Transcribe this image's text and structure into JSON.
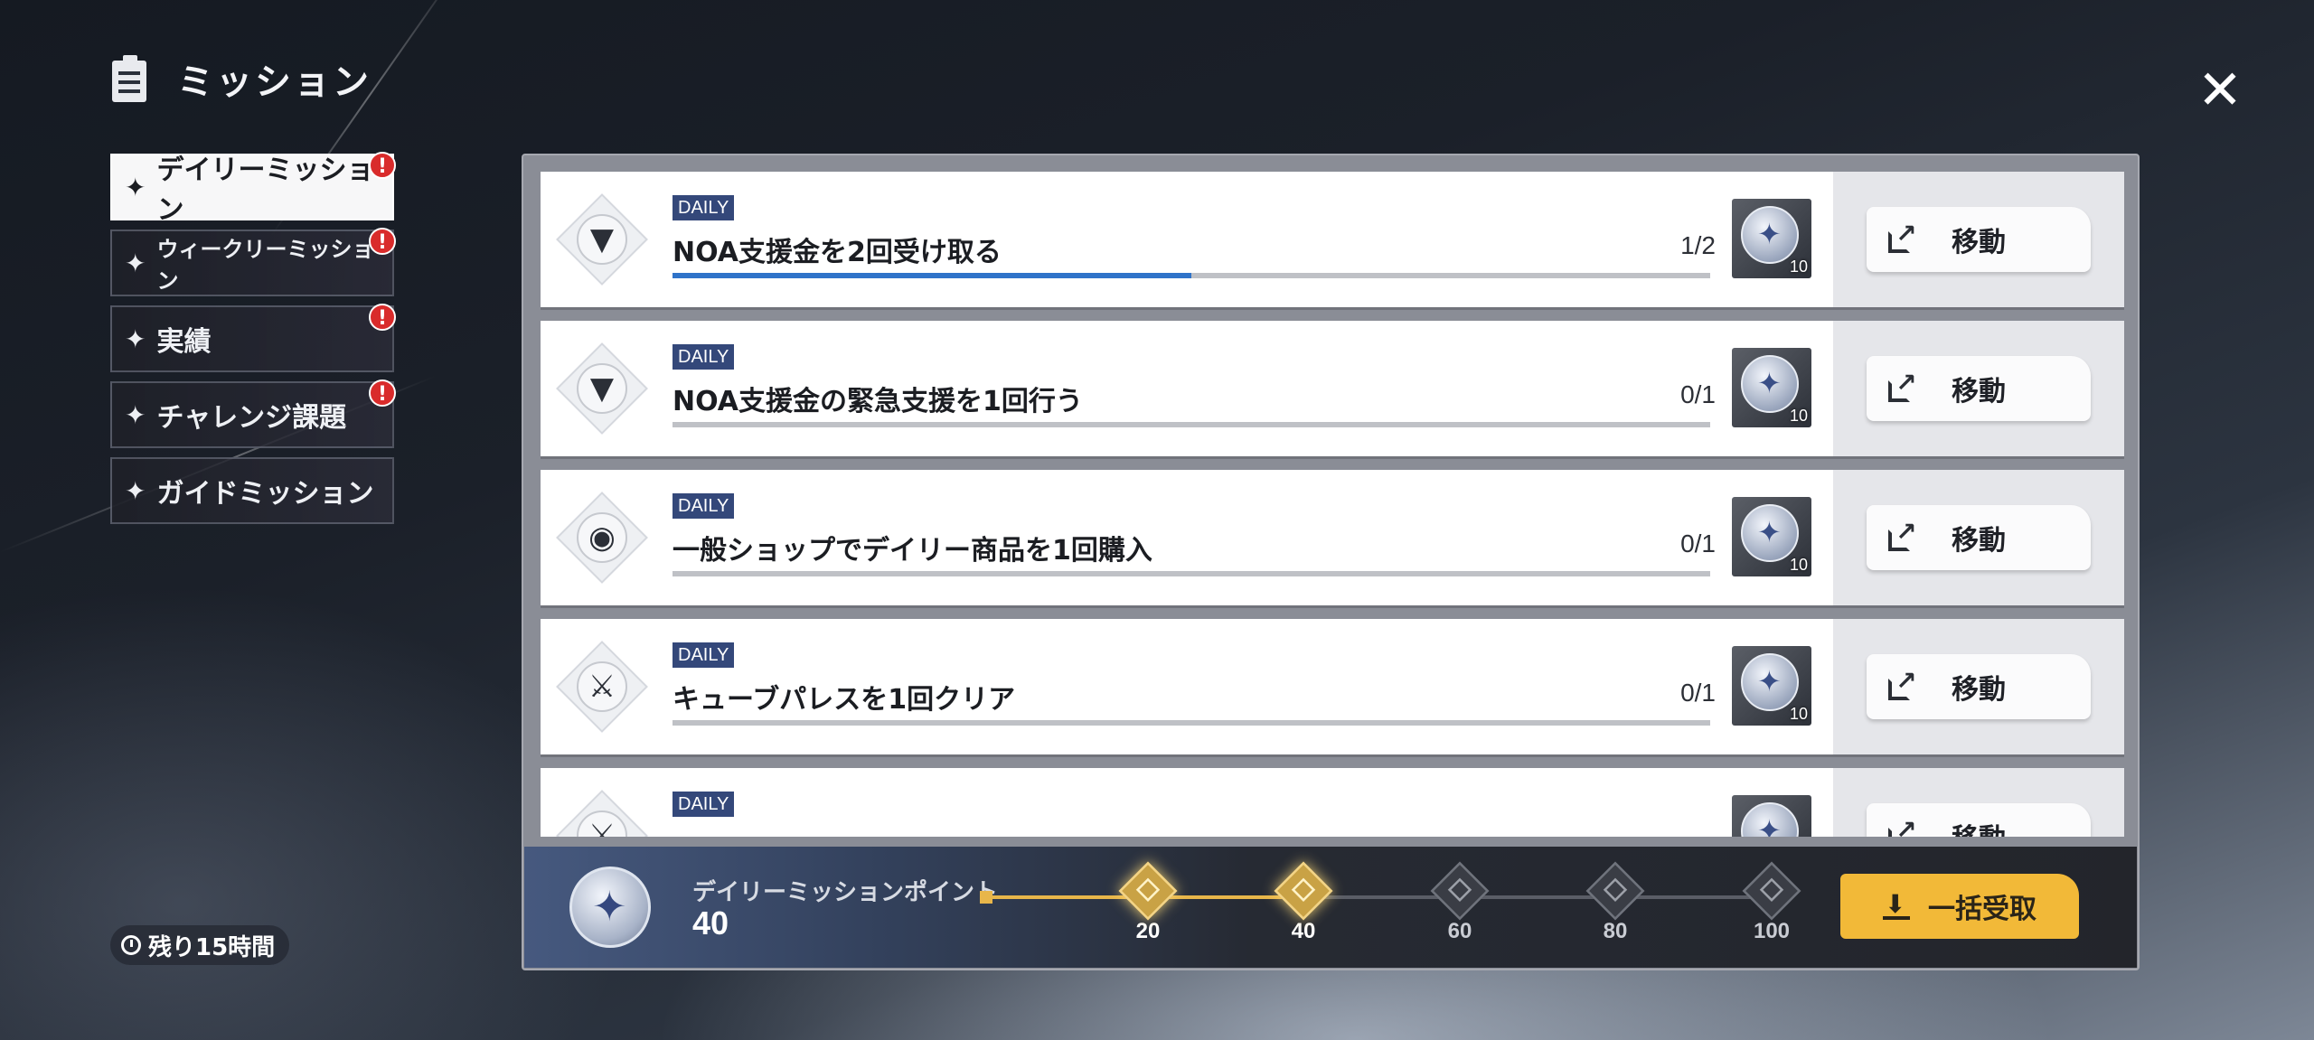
{
  "header": {
    "title": "ミッション"
  },
  "sidebar": {
    "tabs": [
      {
        "label": "デイリーミッション",
        "active": true,
        "alert": "!"
      },
      {
        "label": "ウィークリーミッション",
        "active": false,
        "alert": "!"
      },
      {
        "label": "実績",
        "active": false,
        "alert": "!"
      },
      {
        "label": "チャレンジ課題",
        "active": false,
        "alert": "!"
      },
      {
        "label": "ガイドミッション",
        "active": false,
        "alert": ""
      }
    ],
    "timer": "残り15時間"
  },
  "missions": [
    {
      "tag": "DAILY",
      "title": "NOA支援金を2回受け取る",
      "count": "1/2",
      "progress": 0.5,
      "icon": "triangle-emblem-icon",
      "reward_qty": "10",
      "button": "移動"
    },
    {
      "tag": "DAILY",
      "title": "NOA支援金の緊急支援を1回行う",
      "count": "0/1",
      "progress": 0,
      "icon": "triangle-emblem-icon",
      "reward_qty": "10",
      "button": "移動"
    },
    {
      "tag": "DAILY",
      "title": "一般ショップでデイリー商品を1回購入",
      "count": "0/1",
      "progress": 0,
      "icon": "shop-coin-icon",
      "reward_qty": "10",
      "button": "移動"
    },
    {
      "tag": "DAILY",
      "title": "キューブパレスを1回クリア",
      "count": "0/1",
      "progress": 0,
      "icon": "crossed-axes-icon",
      "reward_qty": "10",
      "button": "移動"
    },
    {
      "tag": "DAILY",
      "title": "",
      "count": "",
      "progress": 0,
      "icon": "crossed-axes-icon",
      "reward_qty": "",
      "button": "移動"
    }
  ],
  "points": {
    "label": "デイリーミッションポイント",
    "value": "40",
    "current": 40,
    "milestones": [
      {
        "value": "20",
        "reached": true
      },
      {
        "value": "40",
        "reached": true
      },
      {
        "value": "60",
        "reached": false
      },
      {
        "value": "80",
        "reached": false
      },
      {
        "value": "100",
        "reached": false
      }
    ],
    "claim_all": "一括受取"
  },
  "colors": {
    "accent_blue": "#2f73c9",
    "claim_yellow": "#f2b938",
    "alert_red": "#d92b2b",
    "daily_tag": "#34487a"
  }
}
